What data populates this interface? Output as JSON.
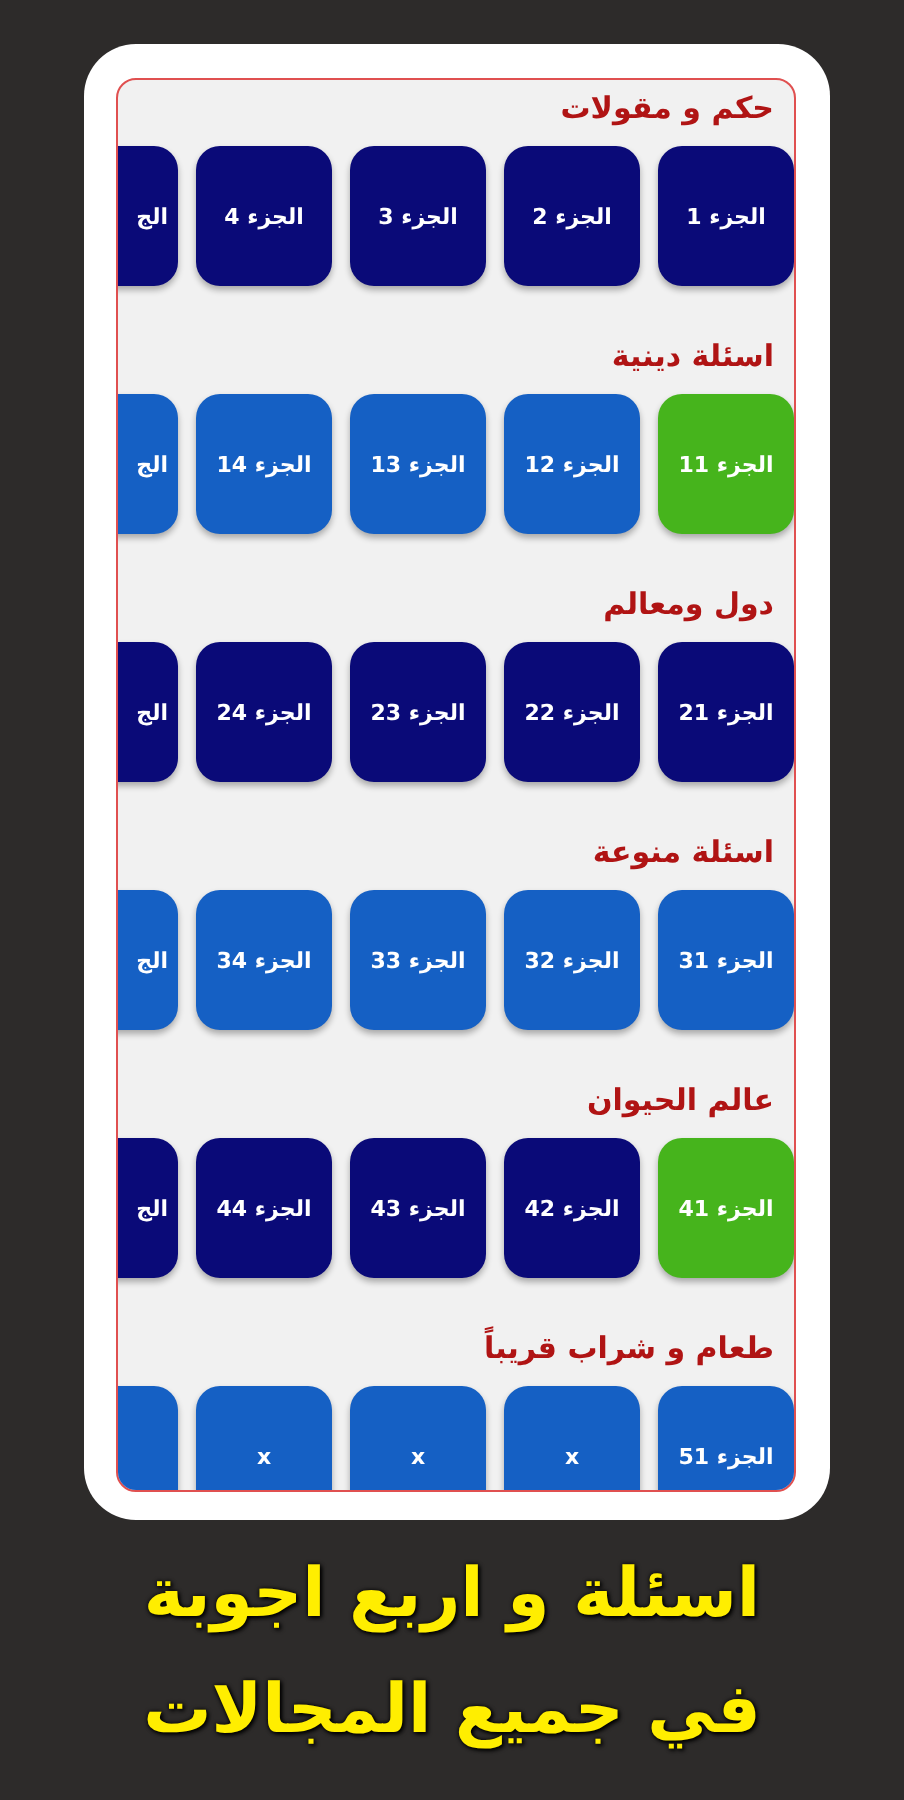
{
  "sections": [
    {
      "title": "حكم و مقولات",
      "tiles": [
        {
          "label": "الجزء 1",
          "color": "#0a0a78"
        },
        {
          "label": "الجزء 2",
          "color": "#0a0a78"
        },
        {
          "label": "الجزء 3",
          "color": "#0a0a78"
        },
        {
          "label": "الجزء 4",
          "color": "#0a0a78"
        },
        {
          "label": "الج",
          "color": "#0a0a78"
        }
      ]
    },
    {
      "title": "اسئلة دينية",
      "tiles": [
        {
          "label": "الجزء 11",
          "color": "#46b41c"
        },
        {
          "label": "الجزء 12",
          "color": "#1560c4"
        },
        {
          "label": "الجزء 13",
          "color": "#1560c4"
        },
        {
          "label": "الجزء 14",
          "color": "#1560c4"
        },
        {
          "label": "الج",
          "color": "#1560c4"
        }
      ]
    },
    {
      "title": "دول ومعالم",
      "tiles": [
        {
          "label": "الجزء 21",
          "color": "#0a0a78"
        },
        {
          "label": "الجزء 22",
          "color": "#0a0a78"
        },
        {
          "label": "الجزء 23",
          "color": "#0a0a78"
        },
        {
          "label": "الجزء 24",
          "color": "#0a0a78"
        },
        {
          "label": "الج",
          "color": "#0a0a78"
        }
      ]
    },
    {
      "title": "اسئلة منوعة",
      "tiles": [
        {
          "label": "الجزء 31",
          "color": "#1560c4"
        },
        {
          "label": "الجزء 32",
          "color": "#1560c4"
        },
        {
          "label": "الجزء 33",
          "color": "#1560c4"
        },
        {
          "label": "الجزء 34",
          "color": "#1560c4"
        },
        {
          "label": "الج",
          "color": "#1560c4"
        }
      ]
    },
    {
      "title": "عالم الحيوان",
      "tiles": [
        {
          "label": "الجزء 41",
          "color": "#46b41c"
        },
        {
          "label": "الجزء 42",
          "color": "#0a0a78"
        },
        {
          "label": "الجزء 43",
          "color": "#0a0a78"
        },
        {
          "label": "الجزء 44",
          "color": "#0a0a78"
        },
        {
          "label": "الج",
          "color": "#0a0a78"
        }
      ]
    },
    {
      "title": "طعام و شراب قريباً",
      "tiles": [
        {
          "label": "الجزء 51",
          "color": "#1560c4"
        },
        {
          "label": "x",
          "color": "#1560c4"
        },
        {
          "label": "x",
          "color": "#1560c4"
        },
        {
          "label": "x",
          "color": "#1560c4"
        },
        {
          "color": "#1560c4"
        }
      ]
    }
  ],
  "caption": [
    "اسئلة و اربع اجوبة",
    "في جميع المجالات"
  ]
}
